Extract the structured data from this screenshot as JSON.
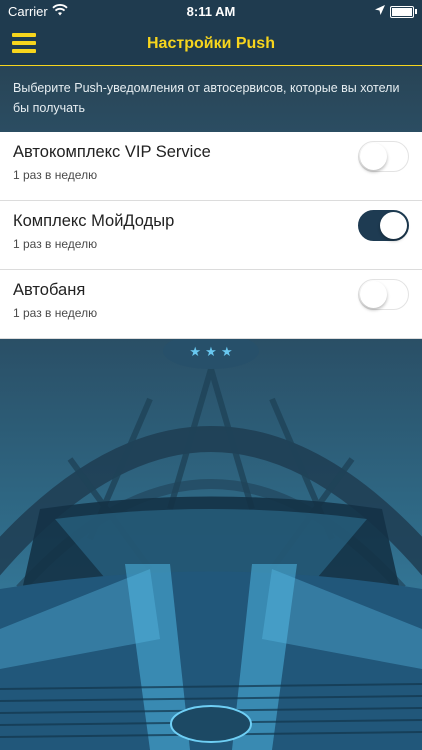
{
  "status_bar": {
    "carrier": "Carrier",
    "time": "8:11 AM"
  },
  "nav": {
    "title": "Настройки Push"
  },
  "hint": "Выберите Push-уведомления от автосервисов, которые вы хотели бы получать",
  "services": [
    {
      "name": "Автокомплекс VIP Service",
      "frequency": "1 раз в неделю",
      "enabled": false
    },
    {
      "name": "Комплекс МойДодыр",
      "frequency": "1 раз в неделю",
      "enabled": true
    },
    {
      "name": "Автобаня",
      "frequency": "1 раз в неделю",
      "enabled": false
    }
  ],
  "colors": {
    "accent": "#f7d51d",
    "header": "#1f3b4f",
    "toggle_on": "#1e3b52"
  }
}
